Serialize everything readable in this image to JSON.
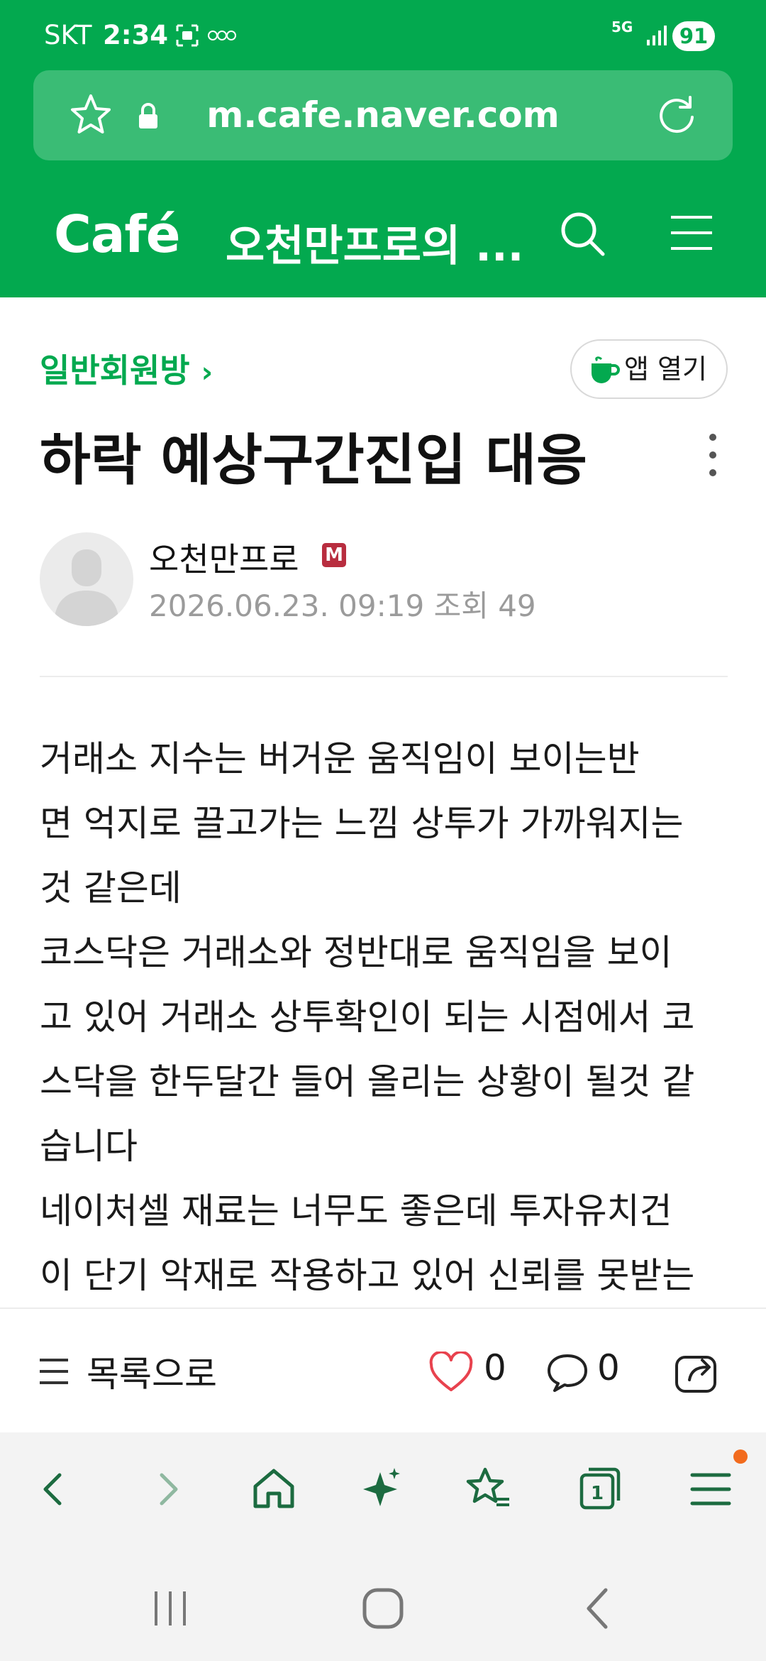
{
  "status_bar": {
    "carrier": "SKT",
    "time": "2:34",
    "network": "5G",
    "battery": "91"
  },
  "browser": {
    "url": "m.cafe.naver.com"
  },
  "cafe_header": {
    "logo": "Café",
    "cafe_name": "오천만프로의 ..."
  },
  "post": {
    "board": "일반회원방",
    "board_chevron": "›",
    "app_open_label": "앱 열기",
    "title": "하락 예상구간진입 대응",
    "author": "오천만프로",
    "author_badge": "M",
    "date": "2026.06.23. 09:19",
    "views_label": "조회 49",
    "body_lines": [
      "거래소 지수는 버거운 움직임이   보이는반",
      "면 억지로 끌고가는 느낌 상투가 가까워지는",
      "것 같은데",
      "코스닥은 거래소와 정반대로 움직임을 보이",
      "고 있어 거래소 상투확인이 되는 시점에서 코",
      "스닥을 한두달간 들어 올리는 상황이 될것 같",
      "습니다",
      "네이처셀 재료는 너무도 좋은데 투자유치건",
      "이 단기 악재로 작용하고 있어 신뢰를 못받는"
    ]
  },
  "post_bar": {
    "list_label": "목록으로",
    "like_count": "0",
    "comment_count": "0"
  },
  "browser_toolbar": {
    "icons": [
      "back-icon",
      "forward-icon",
      "home-icon",
      "ai-sparkle-icon",
      "bookmarks-icon",
      "tabs-icon",
      "menu-icon"
    ],
    "tabs_count": "1"
  },
  "colors": {
    "brand_green": "#03a94f",
    "like_red": "#e8424e",
    "toolbar_green": "#1c6b40",
    "notification_dot": "#f26b1d"
  }
}
